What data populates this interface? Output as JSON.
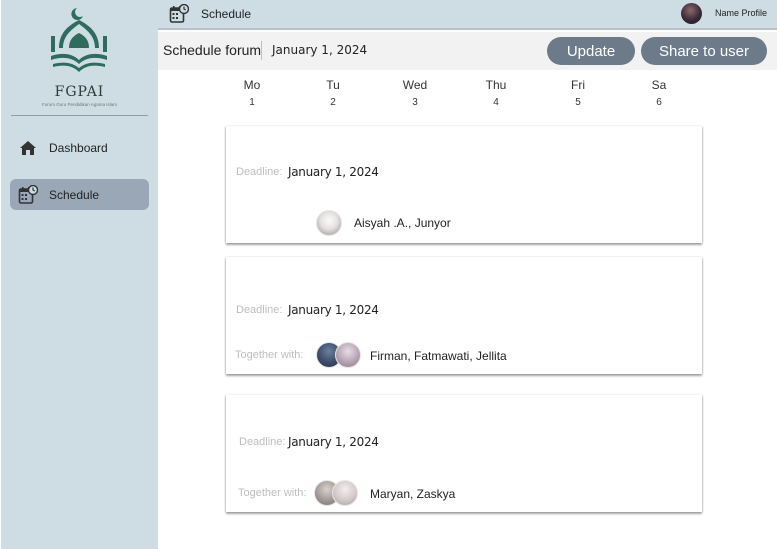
{
  "sidebar": {
    "brand": "FGPAI",
    "brand_subtitle": "Forum Guru Pendidikan Agama Islam",
    "items": [
      {
        "label": "Dashboard",
        "icon": "home-icon"
      },
      {
        "label": "Schedule",
        "icon": "calendar-clock-icon",
        "active": true
      }
    ]
  },
  "topbar": {
    "title": "Schedule",
    "icon": "calendar-clock-icon",
    "profile_name": "Name Profile"
  },
  "subheader": {
    "title": "Schedule forum",
    "date": "January 1, 2024",
    "update_label": "Update",
    "share_label": "Share to user"
  },
  "days": [
    {
      "name": "Mo",
      "num": "1"
    },
    {
      "name": "Tu",
      "num": "2"
    },
    {
      "name": "Wed",
      "num": "3"
    },
    {
      "name": "Thu",
      "num": "4"
    },
    {
      "name": "Fri",
      "num": "5"
    },
    {
      "name": "Sa",
      "num": "6"
    }
  ],
  "cards": [
    {
      "deadline_label": "Deadline:",
      "deadline": "January 1, 2024",
      "together_label": "",
      "people": "Aisyah .A., Junyor"
    },
    {
      "deadline_label": "Deadline:",
      "deadline": "January 1, 2024",
      "together_label": "Together with:",
      "people": "Firman, Fatmawati, Jellita"
    },
    {
      "deadline_label": "Deadline:",
      "deadline": "January 1, 2024",
      "together_label": "Together with:",
      "people": "Maryan, Zaskya"
    }
  ],
  "colors": {
    "sidebar_bg": "#cddde3",
    "active_nav": "#9aa7b7",
    "button_bg": "#6c7a89",
    "logo_green": "#2f6b5e"
  }
}
